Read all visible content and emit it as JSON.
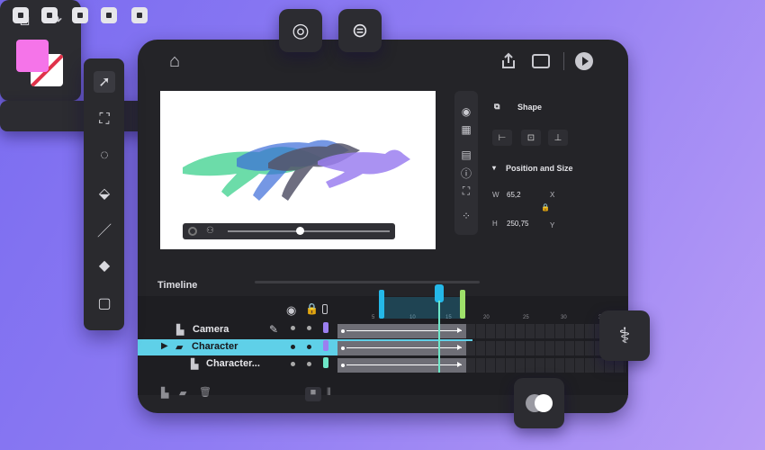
{
  "timeline": {
    "tab_label": "Timeline",
    "rows": [
      {
        "label": "Camera"
      },
      {
        "label": "Character"
      },
      {
        "label": "Character..."
      }
    ],
    "ruler_numbers": [
      "5",
      "10",
      "15",
      "20",
      "25",
      "30",
      "35"
    ]
  },
  "properties": {
    "shape_label": "Shape",
    "section_label": "Position and Size",
    "w_label": "W",
    "w_value": "65,2",
    "h_label": "H",
    "h_value": "250,75",
    "x_label": "X",
    "y_label": "Y"
  },
  "colors": {
    "fill": "#f574e9",
    "accent": "#24b8e8",
    "selection": "#5fd0e8"
  },
  "icons": [
    "home-icon",
    "share-icon",
    "panel-icon",
    "play-icon",
    "select-arrow-icon",
    "transform-icon",
    "lasso-icon",
    "fill-icon",
    "brush-icon",
    "eraser-icon",
    "rectangle-icon",
    "motion-path-icon",
    "morph-icon",
    "duplicate-icon",
    "redo-icon",
    "bones-icon",
    "mask-icon"
  ]
}
